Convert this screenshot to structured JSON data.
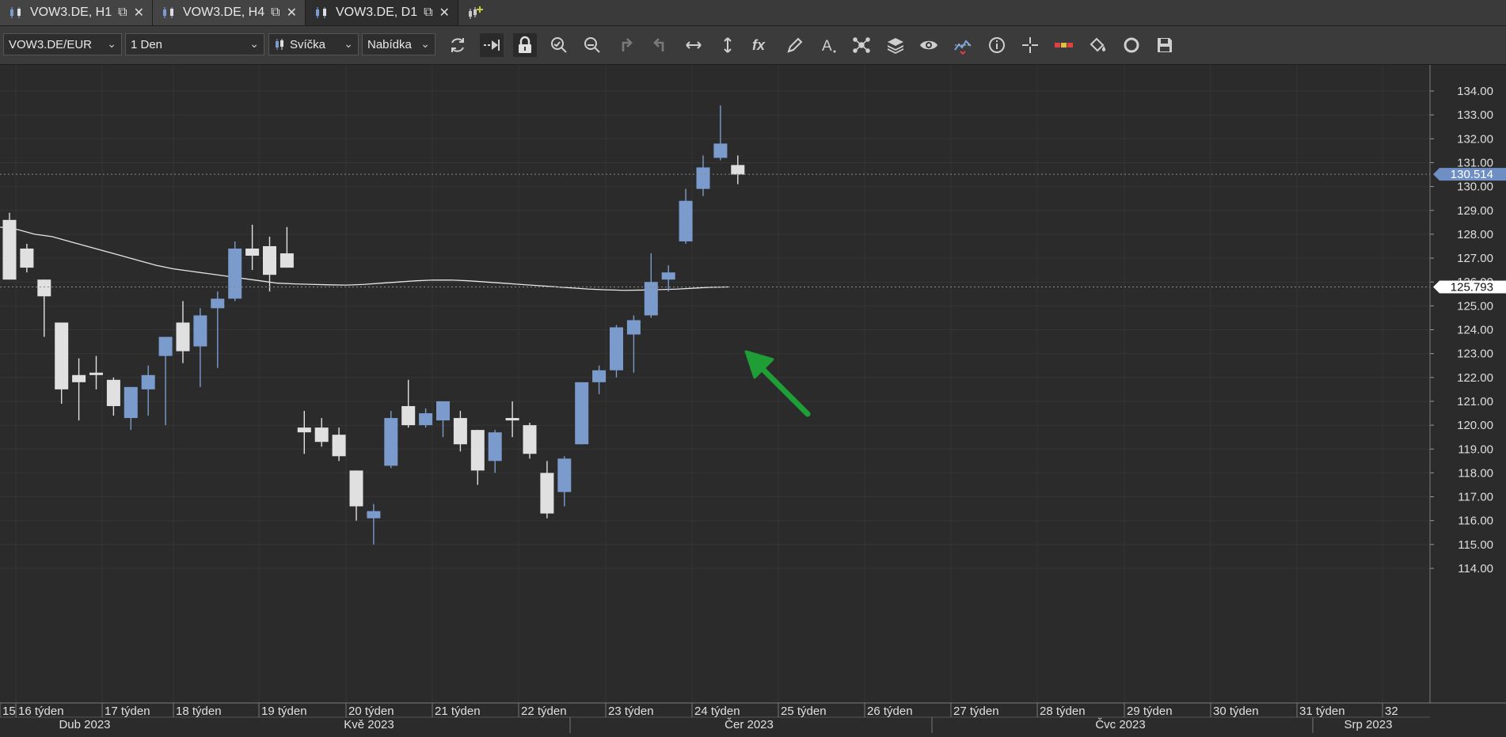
{
  "tabs": [
    {
      "label": "VOW3.DE, H1",
      "active": false
    },
    {
      "label": "VOW3.DE, H4",
      "active": false
    },
    {
      "label": "VOW3.DE, D1",
      "active": true
    }
  ],
  "toolbar": {
    "symbol": "VOW3.DE/EUR",
    "timeframe": "1 Den",
    "chart_type": "Svíčka",
    "price_side": "Nabídka",
    "icons": [
      "refresh-icon",
      "autoscroll-icon",
      "lock-icon",
      "zoom-in-icon",
      "zoom-out-icon",
      "undo-icon",
      "redo-icon",
      "fit-horizontal-icon",
      "fit-vertical-icon",
      "indicators-fx-icon",
      "pencil-icon",
      "text-icon",
      "patterns-icon",
      "layers-icon",
      "eye-icon",
      "alerts-icon",
      "info-icon",
      "crosshair-icon",
      "level-icon",
      "paint-icon",
      "cycle-icon",
      "save-icon"
    ]
  },
  "chart_data": {
    "type": "candlestick",
    "symbol": "VOW3.DE/EUR",
    "timeframe": "D1",
    "ylim": [
      113.6,
      135.0
    ],
    "y_ticks": [
      "134.00",
      "133.00",
      "132.00",
      "131.00",
      "130.00",
      "129.00",
      "128.00",
      "127.00",
      "126.00",
      "125.00",
      "124.00",
      "123.00",
      "122.00",
      "121.00",
      "120.00",
      "119.00",
      "118.00",
      "117.00",
      "116.00",
      "115.00",
      "114.00"
    ],
    "current_price_label": "130.514",
    "ma_label": "125.793",
    "x_week_labels": [
      "15",
      "16 týden",
      "17 týden",
      "18 týden",
      "19 týden",
      "20 týden",
      "21 týden",
      "22 týden",
      "23 týden",
      "24 týden",
      "25 týden",
      "26 týden",
      "27 týden",
      "28 týden",
      "29 týden",
      "30 týden",
      "31 týden",
      "32"
    ],
    "x_month_labels": [
      "Dub 2023",
      "Kvě 2023",
      "Čer 2023",
      "Čvc 2023",
      "Srp 2023"
    ],
    "candles": [
      {
        "o": 126.1,
        "h": 128.9,
        "l": 126.2,
        "c": 128.6,
        "bull": false
      },
      {
        "o": 127.4,
        "h": 127.6,
        "l": 126.4,
        "c": 126.6,
        "bull": false
      },
      {
        "o": 126.1,
        "h": 126.1,
        "l": 123.7,
        "c": 125.4,
        "bull": false
      },
      {
        "o": 124.3,
        "h": 124.2,
        "l": 120.9,
        "c": 121.5,
        "bull": false
      },
      {
        "o": 122.1,
        "h": 122.8,
        "l": 120.2,
        "c": 121.8,
        "bull": false
      },
      {
        "o": 122.2,
        "h": 122.9,
        "l": 121.5,
        "c": 122.1,
        "bull": false
      },
      {
        "o": 121.9,
        "h": 122.0,
        "l": 120.4,
        "c": 120.8,
        "bull": false
      },
      {
        "o": 120.3,
        "h": 121.6,
        "l": 119.8,
        "c": 121.6,
        "bull": true
      },
      {
        "o": 121.5,
        "h": 122.5,
        "l": 120.4,
        "c": 122.1,
        "bull": true
      },
      {
        "o": 122.9,
        "h": 123.5,
        "l": 120.0,
        "c": 123.7,
        "bull": true
      },
      {
        "o": 124.3,
        "h": 125.2,
        "l": 122.6,
        "c": 123.1,
        "bull": false
      },
      {
        "o": 123.3,
        "h": 124.9,
        "l": 121.6,
        "c": 124.6,
        "bull": true
      },
      {
        "o": 124.9,
        "h": 125.6,
        "l": 122.4,
        "c": 125.3,
        "bull": true
      },
      {
        "o": 125.3,
        "h": 127.7,
        "l": 125.2,
        "c": 127.4,
        "bull": true
      },
      {
        "o": 127.4,
        "h": 128.4,
        "l": 126.5,
        "c": 127.1,
        "bull": false
      },
      {
        "o": 127.5,
        "h": 127.9,
        "l": 125.6,
        "c": 126.3,
        "bull": false
      },
      {
        "o": 127.2,
        "h": 128.3,
        "l": 126.6,
        "c": 126.6,
        "bull": false
      },
      {
        "o": 119.9,
        "h": 120.6,
        "l": 118.8,
        "c": 119.7,
        "bull": false
      },
      {
        "o": 119.9,
        "h": 120.3,
        "l": 119.1,
        "c": 119.3,
        "bull": false
      },
      {
        "o": 119.6,
        "h": 119.9,
        "l": 118.5,
        "c": 118.7,
        "bull": false
      },
      {
        "o": 118.1,
        "h": 118.1,
        "l": 116.0,
        "c": 116.6,
        "bull": false
      },
      {
        "o": 116.1,
        "h": 116.7,
        "l": 115.0,
        "c": 116.4,
        "bull": true
      },
      {
        "o": 118.3,
        "h": 120.6,
        "l": 118.2,
        "c": 120.3,
        "bull": true
      },
      {
        "o": 120.8,
        "h": 121.9,
        "l": 119.9,
        "c": 120.0,
        "bull": false
      },
      {
        "o": 120.0,
        "h": 120.7,
        "l": 119.9,
        "c": 120.5,
        "bull": true
      },
      {
        "o": 120.2,
        "h": 120.9,
        "l": 119.5,
        "c": 121.0,
        "bull": true
      },
      {
        "o": 120.3,
        "h": 120.6,
        "l": 118.9,
        "c": 119.2,
        "bull": false
      },
      {
        "o": 119.8,
        "h": 119.8,
        "l": 117.5,
        "c": 118.1,
        "bull": false
      },
      {
        "o": 118.5,
        "h": 119.8,
        "l": 118.0,
        "c": 119.7,
        "bull": true
      },
      {
        "o": 120.3,
        "h": 121.0,
        "l": 119.5,
        "c": 120.2,
        "bull": false
      },
      {
        "o": 120.0,
        "h": 120.1,
        "l": 118.6,
        "c": 118.8,
        "bull": false
      },
      {
        "o": 118.0,
        "h": 118.5,
        "l": 116.1,
        "c": 116.3,
        "bull": false
      },
      {
        "o": 117.2,
        "h": 118.7,
        "l": 116.6,
        "c": 118.6,
        "bull": true
      },
      {
        "o": 119.2,
        "h": 121.8,
        "l": 119.2,
        "c": 121.8,
        "bull": true
      },
      {
        "o": 121.8,
        "h": 122.5,
        "l": 121.3,
        "c": 122.3,
        "bull": true
      },
      {
        "o": 122.3,
        "h": 124.2,
        "l": 122.0,
        "c": 124.1,
        "bull": true
      },
      {
        "o": 123.8,
        "h": 124.6,
        "l": 122.2,
        "c": 124.4,
        "bull": true
      },
      {
        "o": 124.6,
        "h": 127.2,
        "l": 124.5,
        "c": 126.0,
        "bull": true
      },
      {
        "o": 126.1,
        "h": 126.7,
        "l": 125.6,
        "c": 126.4,
        "bull": true
      },
      {
        "o": 127.7,
        "h": 129.9,
        "l": 127.6,
        "c": 129.4,
        "bull": true
      },
      {
        "o": 129.9,
        "h": 131.3,
        "l": 129.6,
        "c": 130.8,
        "bull": true
      },
      {
        "o": 131.2,
        "h": 133.4,
        "l": 131.1,
        "c": 131.8,
        "bull": true
      },
      {
        "o": 130.9,
        "h": 131.3,
        "l": 130.1,
        "c": 130.5,
        "bull": false
      }
    ],
    "ma_series": [
      128.3,
      128.2,
      128.0,
      127.9,
      127.7,
      127.5,
      127.3,
      127.1,
      126.9,
      126.7,
      126.55,
      126.45,
      126.35,
      126.25,
      126.15,
      126.05,
      125.95,
      125.92,
      125.9,
      125.88,
      125.87,
      125.9,
      125.95,
      126.0,
      126.05,
      126.08,
      126.08,
      126.05,
      126.0,
      125.95,
      125.9,
      125.85,
      125.8,
      125.75,
      125.7,
      125.67,
      125.65,
      125.66,
      125.68,
      125.7,
      125.74,
      125.78,
      125.79
    ],
    "annotation": "green-arrow-pointing-to-moving-average",
    "colors": {
      "background": "#2b2b2b",
      "bull_candle": "#7a9bcc",
      "bear_candle": "#e0e0e0",
      "moving_average": "#e6e6e6",
      "price_label_bg": "#6f8fc4",
      "arrow": "#1f9e35"
    }
  }
}
